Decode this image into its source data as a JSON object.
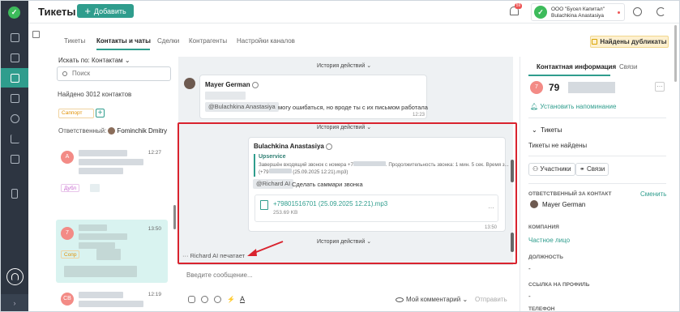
{
  "sidebar": {
    "logo": "✓",
    "items": [
      "grid-icon",
      "copy-icon",
      "ticket-icon",
      "book-icon",
      "users-icon",
      "chart-icon",
      "folder-icon",
      "phone-icon"
    ],
    "expand": "›"
  },
  "topbar": {
    "title": "Тикеты",
    "add_label": "Добавить",
    "notif_count": "59",
    "org": "ООО \"Бусел Капитал\"",
    "user": "Bulachkina Anastasiya"
  },
  "tabs": [
    "Тикеты",
    "Контакты и чаты",
    "Сделки",
    "Контрагенты",
    "Настройки каналов"
  ],
  "duplicates_label": "Найдены дубликаты",
  "contacts": {
    "search_by": "Искать по: Контактам",
    "search_placeholder": "Поиск",
    "found": "Найдено 3012 контактов",
    "tag": "Саппорт",
    "plus": "+",
    "responsible_label": "Ответственный:",
    "responsible_name": "Fominchik Dmitry",
    "cards": [
      {
        "initial": "А",
        "time": "12:27",
        "color": "#f38b86",
        "tag": "Дубл",
        "tag_color": "#c86ad0"
      },
      {
        "initial": "7",
        "time": "13:50",
        "color": "#f38b86",
        "tag": "Сопр",
        "tag_color": "#e08f00"
      },
      {
        "initial": "СВ",
        "time": "12:19",
        "color": "#f38b86",
        "tag": "",
        "tag_color": ""
      }
    ]
  },
  "chat": {
    "history_label": "История действий",
    "msg1": {
      "author": "Mayer German",
      "mention": "@Bulachkina Anastasiya",
      "text": "могу ошибаться, но вроде ты с их письмом работала",
      "time": "12:23"
    },
    "msg2": {
      "author": "Bulachkina Anastasiya",
      "fwd_title": "Upservice",
      "fwd_line1": "Завершён входящий звонок с номера +7",
      "fwd_line1b": ". Продолжительность звонка: 1 мин. 5 сек. Время з...",
      "fwd_line2a": "(+79",
      "fwd_line2b": "(25.09.2025 12:21).mp3)",
      "mention": "@Richard AI",
      "text": "Сделать саммари звонка",
      "file": "+79801516701 (25.09.2025 12:21).mp3",
      "file_size": "253.69 KB",
      "time": "13:50"
    },
    "typing": "Richard AI печатает",
    "input_placeholder": "Введите сообщение...",
    "my_comment": "Мой комментарий",
    "send": "Отправить"
  },
  "right": {
    "tab_info": "Контактная информация",
    "tab_links": "Связи",
    "avatar": "7",
    "number": "79",
    "remind": "Установить напоминание",
    "tickets_title": "Тикеты",
    "tickets_empty": "Тикеты не найдены",
    "participants": "Участники",
    "links": "Связи",
    "owner_label": "ОТВЕТСТВЕННЫЙ ЗА КОНТАКТ",
    "change": "Сменить",
    "owner": "Mayer German",
    "company_label": "КОМПАНИЯ",
    "company": "Частное лицо",
    "position_label": "ДОЛЖНОСТЬ",
    "dash": "-",
    "profile_label": "ССЫЛКА НА ПРОФИЛЬ",
    "phone_label": "ТЕЛЕФОН"
  },
  "colors": {
    "accent": "#2f9d8d",
    "highlight": "#d9232e"
  }
}
